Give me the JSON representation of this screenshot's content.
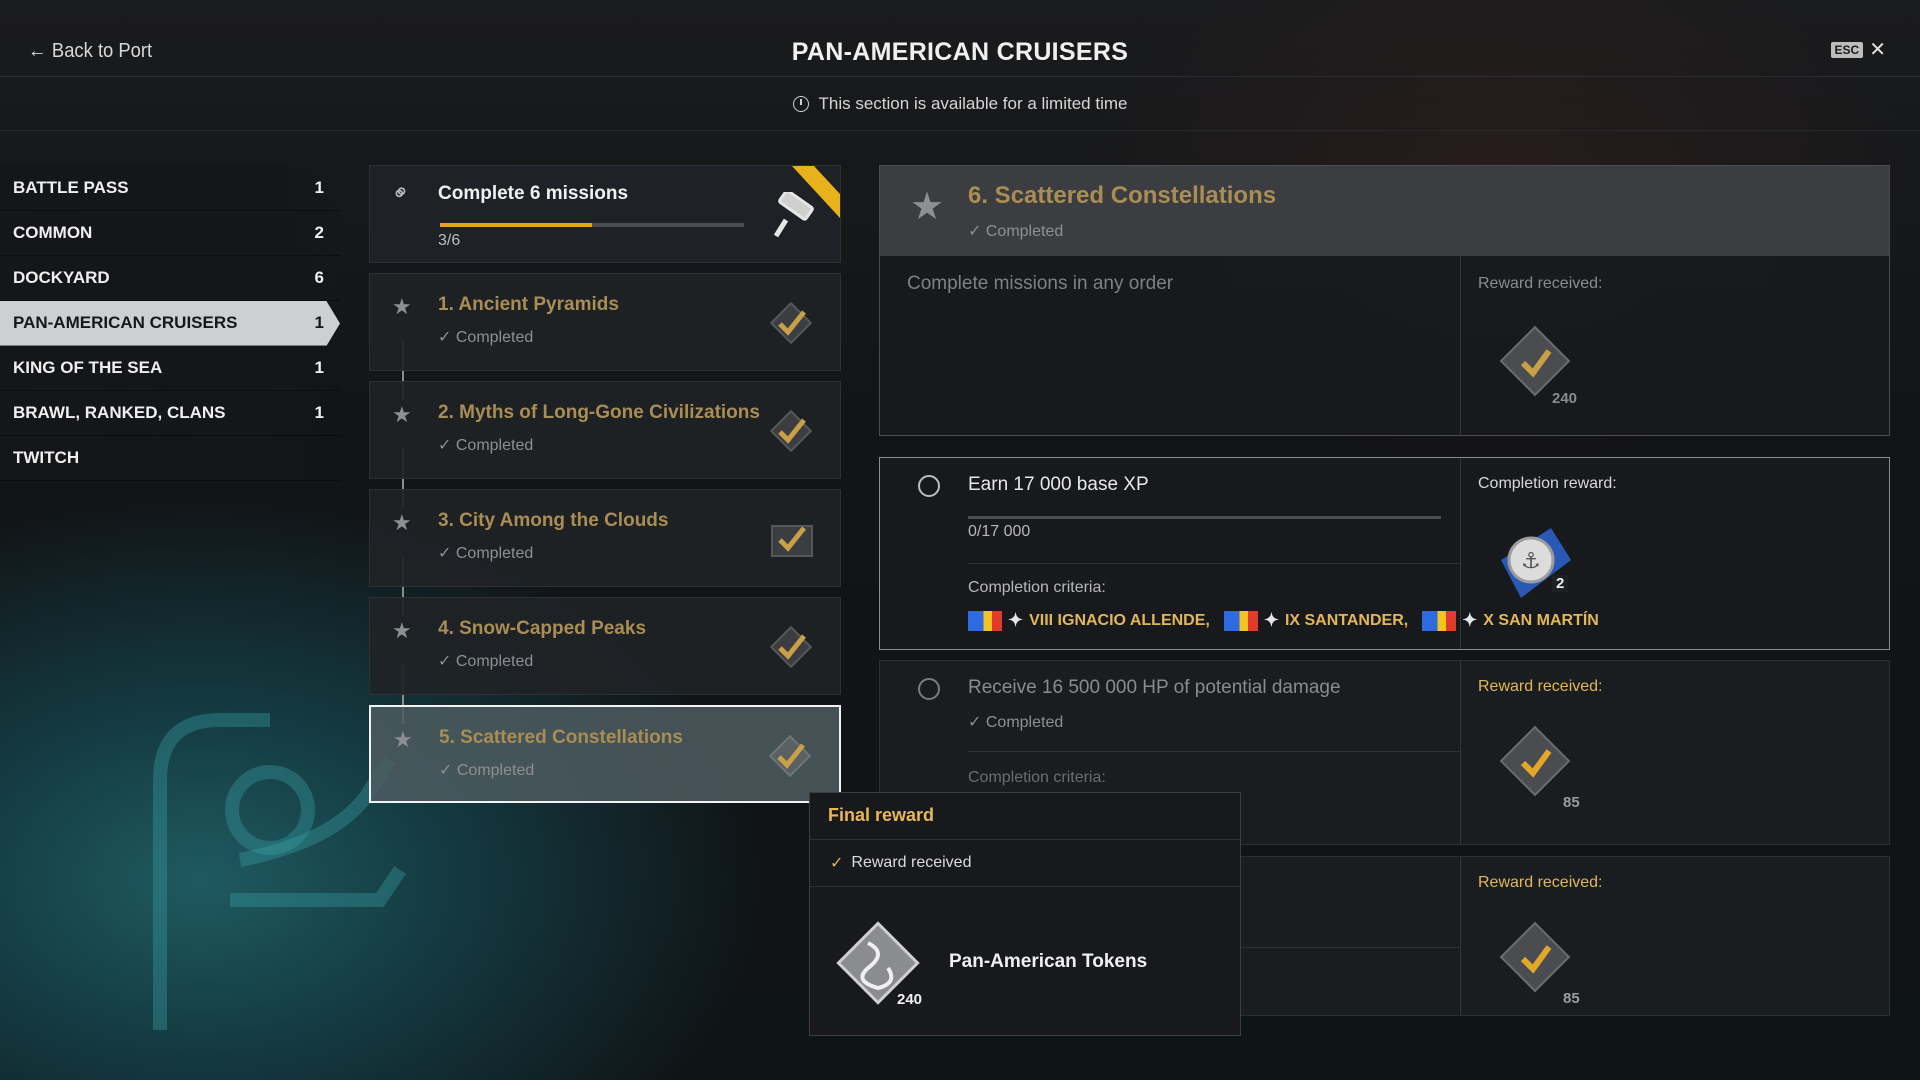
{
  "header": {
    "back_label": "Back to Port",
    "title": "PAN-AMERICAN CRUISERS",
    "esc_label": "ESC",
    "notice": "This section is available for a limited time"
  },
  "sidebar": {
    "items": [
      {
        "label": "BATTLE PASS",
        "count": "1"
      },
      {
        "label": "COMMON",
        "count": "2"
      },
      {
        "label": "DOCKYARD",
        "count": "6"
      },
      {
        "label": "PAN-AMERICAN CRUISERS",
        "count": "1",
        "active": true
      },
      {
        "label": "KING OF THE SEA",
        "count": "1"
      },
      {
        "label": "BRAWL, RANKED, CLANS",
        "count": "1"
      },
      {
        "label": "TWITCH",
        "count": ""
      }
    ]
  },
  "chain": {
    "title": "Complete 6 missions",
    "progress_text": "3/6",
    "progress_fraction": 0.5,
    "missions": [
      {
        "name": "1. Ancient Pyramids",
        "status": "Completed"
      },
      {
        "name": "2. Myths of Long-Gone Civilizations",
        "status": "Completed"
      },
      {
        "name": "3. City Among the Clouds",
        "status": "Completed"
      },
      {
        "name": "4. Snow-Capped Peaks",
        "status": "Completed"
      },
      {
        "name": "5. Scattered Constellations",
        "status": "Completed"
      }
    ]
  },
  "detail": {
    "title": "6. Scattered Constellations",
    "status": "Completed",
    "description": "Complete missions in any order",
    "reward_label": "Reward received:",
    "reward_amount": "240",
    "tasks": [
      {
        "text": "Earn 17 000 base XP",
        "progress_text": "0/17 000",
        "progress_fraction": 0,
        "criteria_label": "Completion criteria:",
        "ships": [
          "VIII IGNACIO ALLENDE,",
          "IX SANTANDER,",
          "X SAN MARTÍN"
        ],
        "reward_label": "Completion reward:",
        "reward_amount": "2"
      },
      {
        "text": "Receive 16 500 000 HP of potential damage",
        "status": "Completed",
        "criteria_label": "Completion criteria:",
        "reward_label": "Reward received:",
        "reward_amount": "85"
      },
      {
        "reward_label": "Reward received:",
        "reward_amount": "85"
      }
    ]
  },
  "popup": {
    "title": "Final reward",
    "status": "Reward received",
    "item_name": "Pan-American Tokens",
    "item_amount": "240"
  },
  "colors": {
    "accent_gold": "#e3b65a",
    "progress_orange": "#e7a31f",
    "completed_gold": "#a98d54"
  }
}
